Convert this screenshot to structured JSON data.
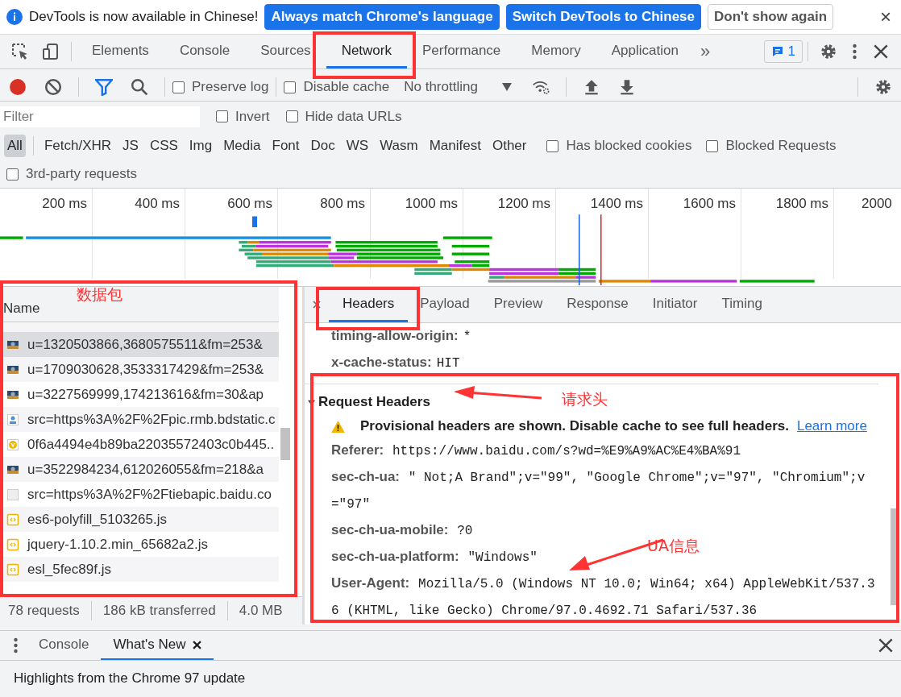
{
  "infobar": {
    "message": "DevTools is now available in Chinese!",
    "buttons": [
      {
        "label": "Always match Chrome's language",
        "kind": "primary"
      },
      {
        "label": "Switch DevTools to Chinese",
        "kind": "primary"
      },
      {
        "label": "Don't show again",
        "kind": "secondary"
      }
    ],
    "close": "×"
  },
  "main_tabs": [
    {
      "label": "Elements",
      "selected": false
    },
    {
      "label": "Console",
      "selected": false
    },
    {
      "label": "Sources",
      "selected": false
    },
    {
      "label": "Network",
      "selected": true
    },
    {
      "label": "Performance",
      "selected": false
    },
    {
      "label": "Memory",
      "selected": false
    },
    {
      "label": "Application",
      "selected": false
    }
  ],
  "overflow": "»",
  "issues_count": "1",
  "toolbar": {
    "recording": true,
    "preserve_log": {
      "label": "Preserve log",
      "checked": false
    },
    "disable_cache": {
      "label": "Disable cache",
      "checked": false
    },
    "throttling": "No throttling"
  },
  "filter": {
    "placeholder": "Filter",
    "invert": {
      "label": "Invert",
      "checked": false
    },
    "hide_data_urls": {
      "label": "Hide data URLs",
      "checked": false
    }
  },
  "type_filters": [
    {
      "label": "All",
      "selected": true
    },
    {
      "label": "Fetch/XHR",
      "selected": false
    },
    {
      "label": "JS",
      "selected": false
    },
    {
      "label": "CSS",
      "selected": false
    },
    {
      "label": "Img",
      "selected": false
    },
    {
      "label": "Media",
      "selected": false
    },
    {
      "label": "Font",
      "selected": false
    },
    {
      "label": "Doc",
      "selected": false
    },
    {
      "label": "WS",
      "selected": false
    },
    {
      "label": "Wasm",
      "selected": false
    },
    {
      "label": "Manifest",
      "selected": false
    },
    {
      "label": "Other",
      "selected": false
    }
  ],
  "has_blocked_cookies": {
    "label": "Has blocked cookies",
    "checked": false
  },
  "blocked_requests": {
    "label": "Blocked Requests",
    "checked": false
  },
  "third_party": {
    "label": "3rd-party requests",
    "checked": false
  },
  "timeline": {
    "ticks": [
      "200 ms",
      "400 ms",
      "600 ms",
      "800 ms",
      "1000 ms",
      "1200 ms",
      "1400 ms",
      "1600 ms",
      "1800 ms",
      "2000"
    ]
  },
  "request_list": {
    "header": "Name",
    "rows": [
      {
        "name": "u=1320503866,3680575511&fm=253&",
        "kind": "photo",
        "selected": true
      },
      {
        "name": "u=1709030628,3533317429&fm=253&",
        "kind": "photo",
        "selected": false
      },
      {
        "name": "u=3227569999,174213616&fm=30&ap",
        "kind": "photo",
        "selected": false
      },
      {
        "name": "src=https%3A%2F%2Fpic.rmb.bdstatic.c",
        "kind": "image",
        "selected": false
      },
      {
        "name": "0f6a4494e4b89ba22035572403c0b445..",
        "kind": "favicon",
        "selected": false
      },
      {
        "name": "u=3522984234,612026055&fm=218&a",
        "kind": "photo",
        "selected": false
      },
      {
        "name": "src=https%3A%2F%2Ftiebapic.baidu.co",
        "kind": "blank",
        "selected": false
      },
      {
        "name": "es6-polyfill_5103265.js",
        "kind": "script",
        "selected": false
      },
      {
        "name": "jquery-1.10.2.min_65682a2.js",
        "kind": "script",
        "selected": false
      },
      {
        "name": "esl_5fec89f.js",
        "kind": "script",
        "selected": false
      }
    ]
  },
  "status": [
    "78 requests",
    "186 kB transferred",
    "4.0 MB"
  ],
  "detail_tabs": [
    {
      "label": "Headers",
      "selected": true
    },
    {
      "label": "Payload",
      "selected": false
    },
    {
      "label": "Preview",
      "selected": false
    },
    {
      "label": "Response",
      "selected": false
    },
    {
      "label": "Initiator",
      "selected": false
    },
    {
      "label": "Timing",
      "selected": false
    }
  ],
  "response_headers": [
    {
      "name": "timing-allow-origin:",
      "value": "*"
    },
    {
      "name": "x-cache-status:",
      "value": "HIT"
    }
  ],
  "request_headers": {
    "title": "Request Headers",
    "expanded": true,
    "warning": "Provisional headers are shown. Disable cache to see full headers.",
    "link": "Learn more",
    "rows": [
      {
        "name": "Referer:",
        "value": "https://www.baidu.com/s?wd=%E9%A9%AC%E4%BA%91"
      },
      {
        "name": "sec-ch-ua:",
        "value": "\" Not;A Brand\";v=\"99\", \"Google Chrome\";v=\"97\", \"Chromium\";v=\"97\""
      },
      {
        "name": "sec-ch-ua-mobile:",
        "value": "?0"
      },
      {
        "name": "sec-ch-ua-platform:",
        "value": "\"Windows\""
      },
      {
        "name": "User-Agent:",
        "value": "Mozilla/5.0 (Windows NT 10.0; Win64; x64) AppleWebKit/537.36 (KHTML, like Gecko) Chrome/97.0.4692.71 Safari/537.36"
      }
    ]
  },
  "drawer": {
    "tabs": [
      {
        "label": "Console",
        "selected": false,
        "closable": false
      },
      {
        "label": "What's New",
        "selected": true,
        "closable": true
      }
    ],
    "content": "Highlights from the Chrome 97 update"
  },
  "annotations": [
    {
      "text": "数据包"
    },
    {
      "text": "请求头"
    },
    {
      "text": "UA信息"
    }
  ]
}
